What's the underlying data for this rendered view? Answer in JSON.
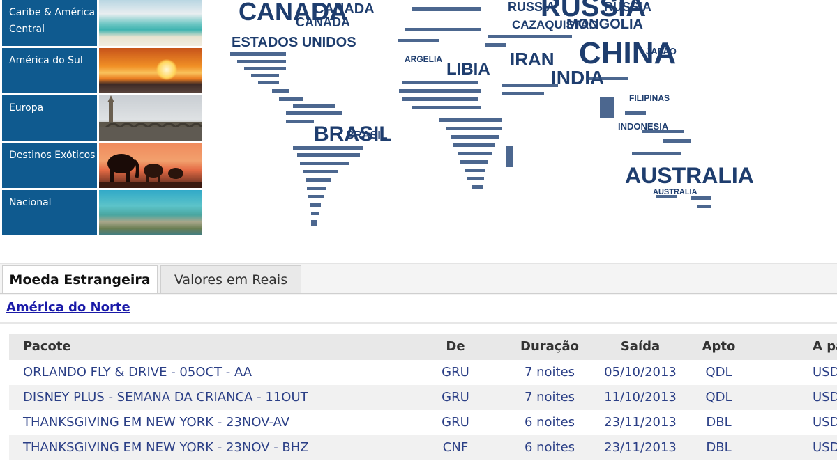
{
  "regions": [
    {
      "label": "Caribe & América Central"
    },
    {
      "label": "América do Sul"
    },
    {
      "label": "Europa"
    },
    {
      "label": "Destinos Exóticos"
    },
    {
      "label": "Nacional"
    }
  ],
  "map_words": {
    "canada": "CANADA",
    "canada_small": "CANADA",
    "canada_small2": "CANADA",
    "eua": "ESTADOS UNIDOS",
    "russia": "RUSSIA",
    "russia_small": "RUSSIA",
    "china": "CHINA",
    "mongolia": "MONGOLIA",
    "cazaquistao": "CAZAQUISTAO",
    "iran": "IRAN",
    "india": "INDIA",
    "libia": "LIBIA",
    "brasil": "BRASIL",
    "brasil_small": "BRASIL",
    "australia": "AUSTRALIA",
    "australia_small": "AUSTRALIA",
    "filipinas": "FILIPINAS",
    "indonesia": "INDONESIA",
    "argelia": "ARGELIA",
    "japao": "JAPAO"
  },
  "tabs": {
    "active": "Moeda Estrangeira",
    "inactive": "Valores em Reais"
  },
  "region_link": "América do Norte",
  "table": {
    "headers": {
      "pacote": "Pacote",
      "de": "De",
      "duracao": "Duração",
      "saida": "Saída",
      "apto": "Apto",
      "apartir": "A pa"
    },
    "rows": [
      {
        "pacote": "ORLANDO FLY & DRIVE - 05OCT - AA",
        "de": "GRU",
        "duracao": "7 noites",
        "saida": "05/10/2013",
        "apto": "QDL",
        "apartir": "USD"
      },
      {
        "pacote": "DISNEY PLUS - SEMANA DA CRIANCA - 11OUT",
        "de": "GRU",
        "duracao": "7 noites",
        "saida": "11/10/2013",
        "apto": "QDL",
        "apartir": "USD"
      },
      {
        "pacote": "THANKSGIVING EM NEW YORK - 23NOV-AV",
        "de": "GRU",
        "duracao": "6 noites",
        "saida": "23/11/2013",
        "apto": "DBL",
        "apartir": "USD"
      },
      {
        "pacote": "THANKSGIVING EM NEW YORK - 23NOV - BHZ",
        "de": "CNF",
        "duracao": "6 noites",
        "saida": "23/11/2013",
        "apto": "DBL",
        "apartir": "USD"
      }
    ]
  },
  "colors": {
    "region_blue": "#0f5a8f",
    "map_navy": "#1e3d6e",
    "link_blue": "#1a1aa8",
    "row_text": "#2b3f86"
  }
}
